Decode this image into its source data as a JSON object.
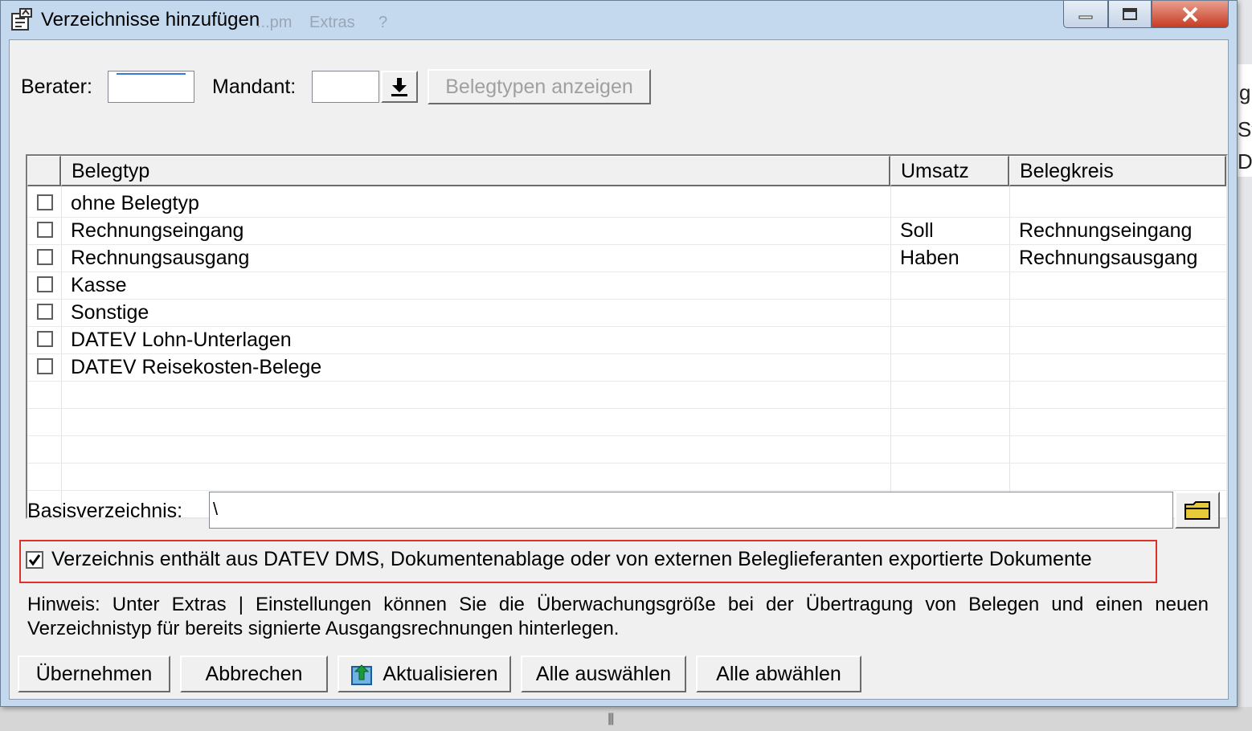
{
  "window": {
    "title": "Verzeichnisse hinzufügen"
  },
  "background_menu": {
    "item1": "...pm",
    "item2": "Extras",
    "item3": "?"
  },
  "background_right": {
    "a": "g",
    "b": "St",
    "c": "DI"
  },
  "toolbar": {
    "berater_label": "Berater:",
    "berater_value": "",
    "mandant_label": "Mandant:",
    "mandant_value": "",
    "show_types_label": "Belegtypen anzeigen"
  },
  "grid": {
    "columns": [
      "Belegtyp",
      "Umsatz",
      "Belegkreis"
    ],
    "rows": [
      {
        "checked": false,
        "belegtyp": "ohne Belegtyp",
        "umsatz": "",
        "belegkreis": ""
      },
      {
        "checked": false,
        "belegtyp": "Rechnungseingang",
        "umsatz": "Soll",
        "belegkreis": "Rechnungseingang"
      },
      {
        "checked": false,
        "belegtyp": "Rechnungsausgang",
        "umsatz": "Haben",
        "belegkreis": "Rechnungsausgang"
      },
      {
        "checked": false,
        "belegtyp": "Kasse",
        "umsatz": "",
        "belegkreis": ""
      },
      {
        "checked": false,
        "belegtyp": "Sonstige",
        "umsatz": "",
        "belegkreis": ""
      },
      {
        "checked": false,
        "belegtyp": "DATEV Lohn-Unterlagen",
        "umsatz": "",
        "belegkreis": ""
      },
      {
        "checked": false,
        "belegtyp": "DATEV Reisekosten-Belege",
        "umsatz": "",
        "belegkreis": ""
      }
    ]
  },
  "basis": {
    "label": "Basisverzeichnis:",
    "value": "\\"
  },
  "dms_checkbox": {
    "checked": true,
    "label": "Verzeichnis enthält aus DATEV DMS, Dokumentenablage oder von externen Beleglieferanten exportierte Dokumente"
  },
  "hint": "Hinweis: Unter Extras | Einstellungen können Sie die Überwachungsgröße bei der Übertragung von Belegen und einen neuen Verzeichnistyp für bereits signierte Ausgangsrechnungen hinterlegen.",
  "buttons": {
    "apply": "Übernehmen",
    "cancel": "Abbrechen",
    "refresh": "Aktualisieren",
    "select_all": "Alle auswählen",
    "deselect_all": "Alle abwählen"
  },
  "icons": {
    "app": "document-window-icon",
    "download": "download-arrow-icon",
    "folder": "folder-icon",
    "refresh": "refresh-upload-icon"
  },
  "colors": {
    "titlebar": "#c4d8ee",
    "close": "#c63b23",
    "highlight_border": "#e0302c"
  }
}
